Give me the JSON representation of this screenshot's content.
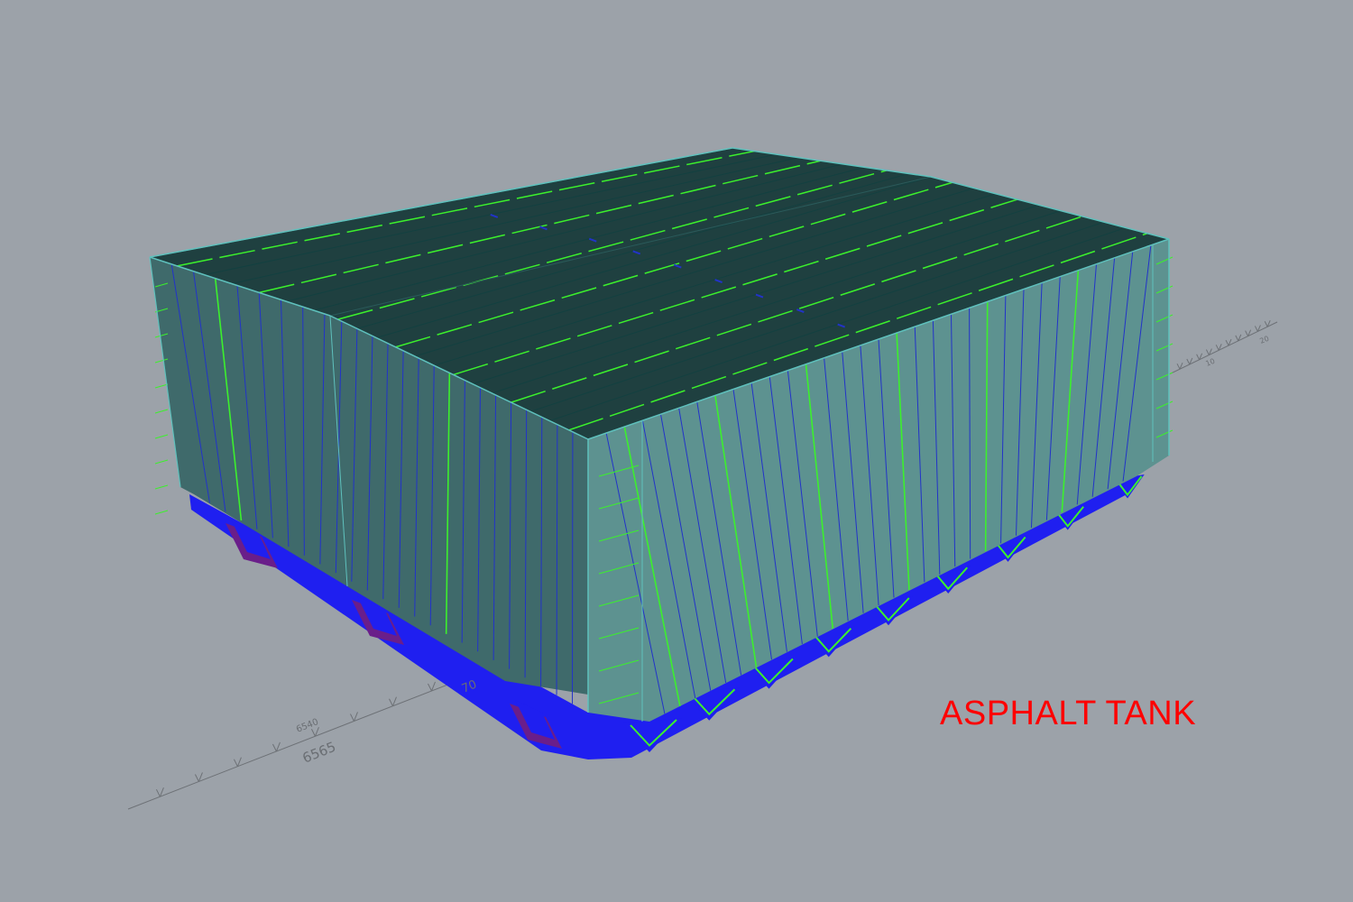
{
  "title": "ASPHALT TANK",
  "colors": {
    "background": "#9ca2a9",
    "roof": "#1f4040",
    "front_wall": "#5d9290",
    "side_wall": "#3f6a6b",
    "edge": "#5fc1bd",
    "green_line": "#3cf02c",
    "blue_line": "#2233c8",
    "base_blue": "#1f1ff0",
    "base_purple": "#6a1e8a",
    "title_color": "#ff0000",
    "axis_color": "#6d7176"
  },
  "axis": {
    "ticks": [
      "6565",
      "6540",
      "70",
      "10",
      "20"
    ]
  }
}
